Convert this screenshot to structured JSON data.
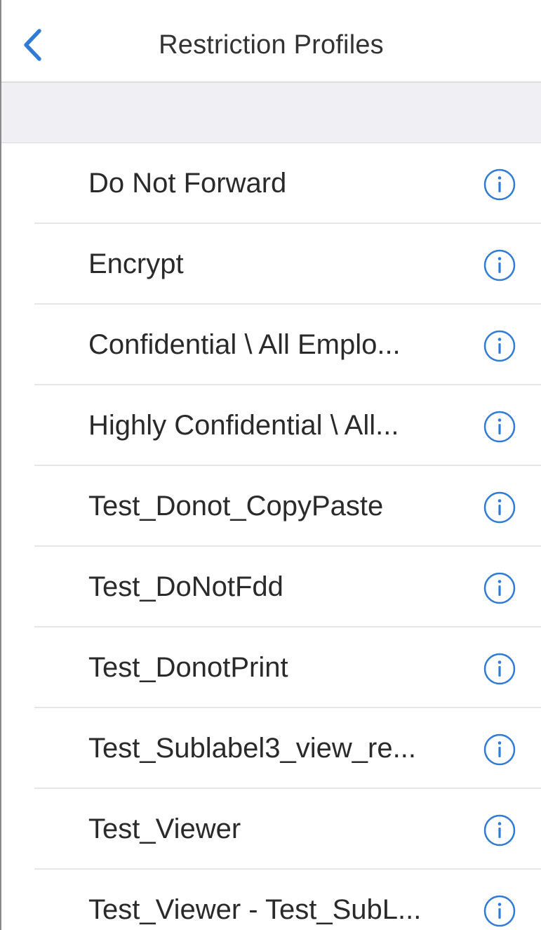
{
  "nav": {
    "title": "Restriction Profiles",
    "back_icon": "chevron-left-icon"
  },
  "colors": {
    "accent": "#2f7bd6",
    "section_background": "#efeff4",
    "separator": "#e6e6e6",
    "text": "#2a2a2a"
  },
  "profiles": [
    {
      "label": "Do Not Forward",
      "icon": "info-icon"
    },
    {
      "label": "Encrypt",
      "icon": "info-icon"
    },
    {
      "label": "Confidential \\ All Emplo...",
      "icon": "info-icon"
    },
    {
      "label": "Highly Confidential \\ All...",
      "icon": "info-icon"
    },
    {
      "label": "Test_Donot_CopyPaste",
      "icon": "info-icon"
    },
    {
      "label": "Test_DoNotFdd",
      "icon": "info-icon"
    },
    {
      "label": "Test_DonotPrint",
      "icon": "info-icon"
    },
    {
      "label": "Test_Sublabel3_view_re...",
      "icon": "info-icon"
    },
    {
      "label": "Test_Viewer",
      "icon": "info-icon"
    },
    {
      "label": "Test_Viewer - Test_SubL...",
      "icon": "info-icon"
    }
  ]
}
